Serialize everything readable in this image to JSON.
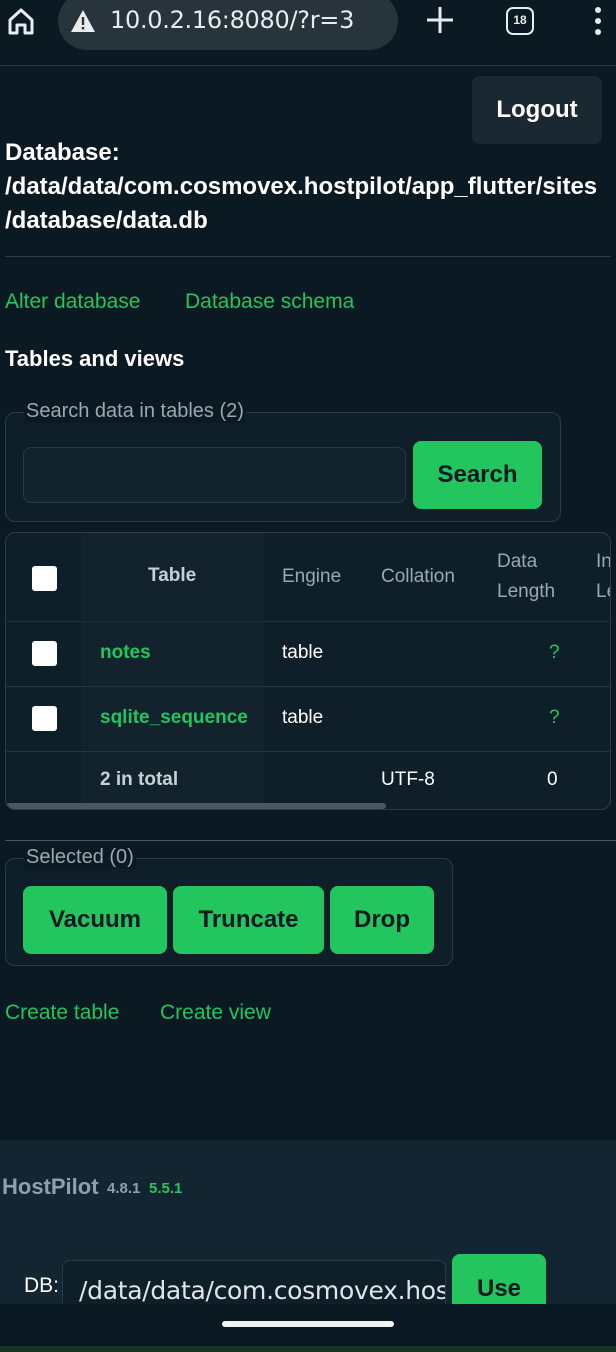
{
  "browser": {
    "url": "10.0.2.16:8080/?r=3",
    "tab_count": "18"
  },
  "header": {
    "logout_label": "Logout",
    "db_label": "Database:",
    "db_path_line1": "/data/data/com.cosmovex.hostpilot/app_flutter/sites",
    "db_path_line2": "/database/data.db"
  },
  "links": {
    "alter_database": "Alter database",
    "database_schema": "Database schema",
    "create_table": "Create table",
    "create_view": "Create view"
  },
  "tables_heading": "Tables and views",
  "search": {
    "legend": "Search data in tables (2)",
    "value": "",
    "button_label": "Search"
  },
  "table": {
    "headers": {
      "table": "Table",
      "engine": "Engine",
      "collation": "Collation",
      "data_length_1": "Data",
      "data_length_2": "Length",
      "index_length_1": "In",
      "index_length_2": "Le"
    },
    "rows": [
      {
        "name": "notes",
        "engine": "table",
        "collation": "",
        "data_length": "?"
      },
      {
        "name": "sqlite_sequence",
        "engine": "table",
        "collation": "",
        "data_length": "?"
      }
    ],
    "total": {
      "label": "2 in total",
      "collation": "UTF-8",
      "data_length": "0"
    }
  },
  "selected": {
    "legend": "Selected (0)",
    "vacuum_label": "Vacuum",
    "truncate_label": "Truncate",
    "drop_label": "Drop"
  },
  "footer": {
    "brand": "HostPilot",
    "version_app": "4.8.1",
    "version_latest": "5.5.1",
    "db_label": "DB:",
    "db_value": "/data/data/com.cosmovex.hos",
    "use_label": "Use"
  },
  "colors": {
    "accent_green": "#22c55e",
    "background": "#0b1a22"
  }
}
